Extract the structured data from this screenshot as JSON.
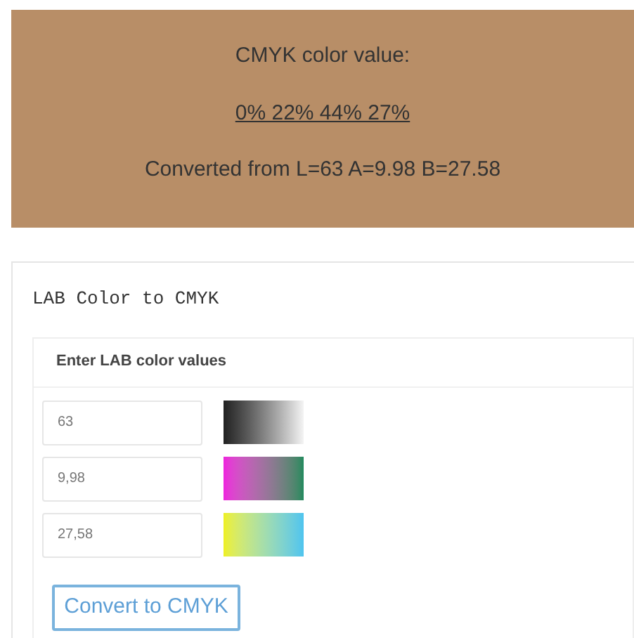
{
  "result": {
    "heading": "CMYK color value:",
    "cmyk": "0% 22% 44% 27%",
    "source": "Converted from L=63 A=9.98 B=27.58"
  },
  "panel": {
    "title": "LAB Color to CMYK",
    "card_header": "Enter LAB color values",
    "fields": [
      {
        "kind": "l",
        "value": "63"
      },
      {
        "kind": "a",
        "value": "9,98"
      },
      {
        "kind": "b",
        "value": "27,58"
      }
    ],
    "button": "Convert to CMYK"
  }
}
